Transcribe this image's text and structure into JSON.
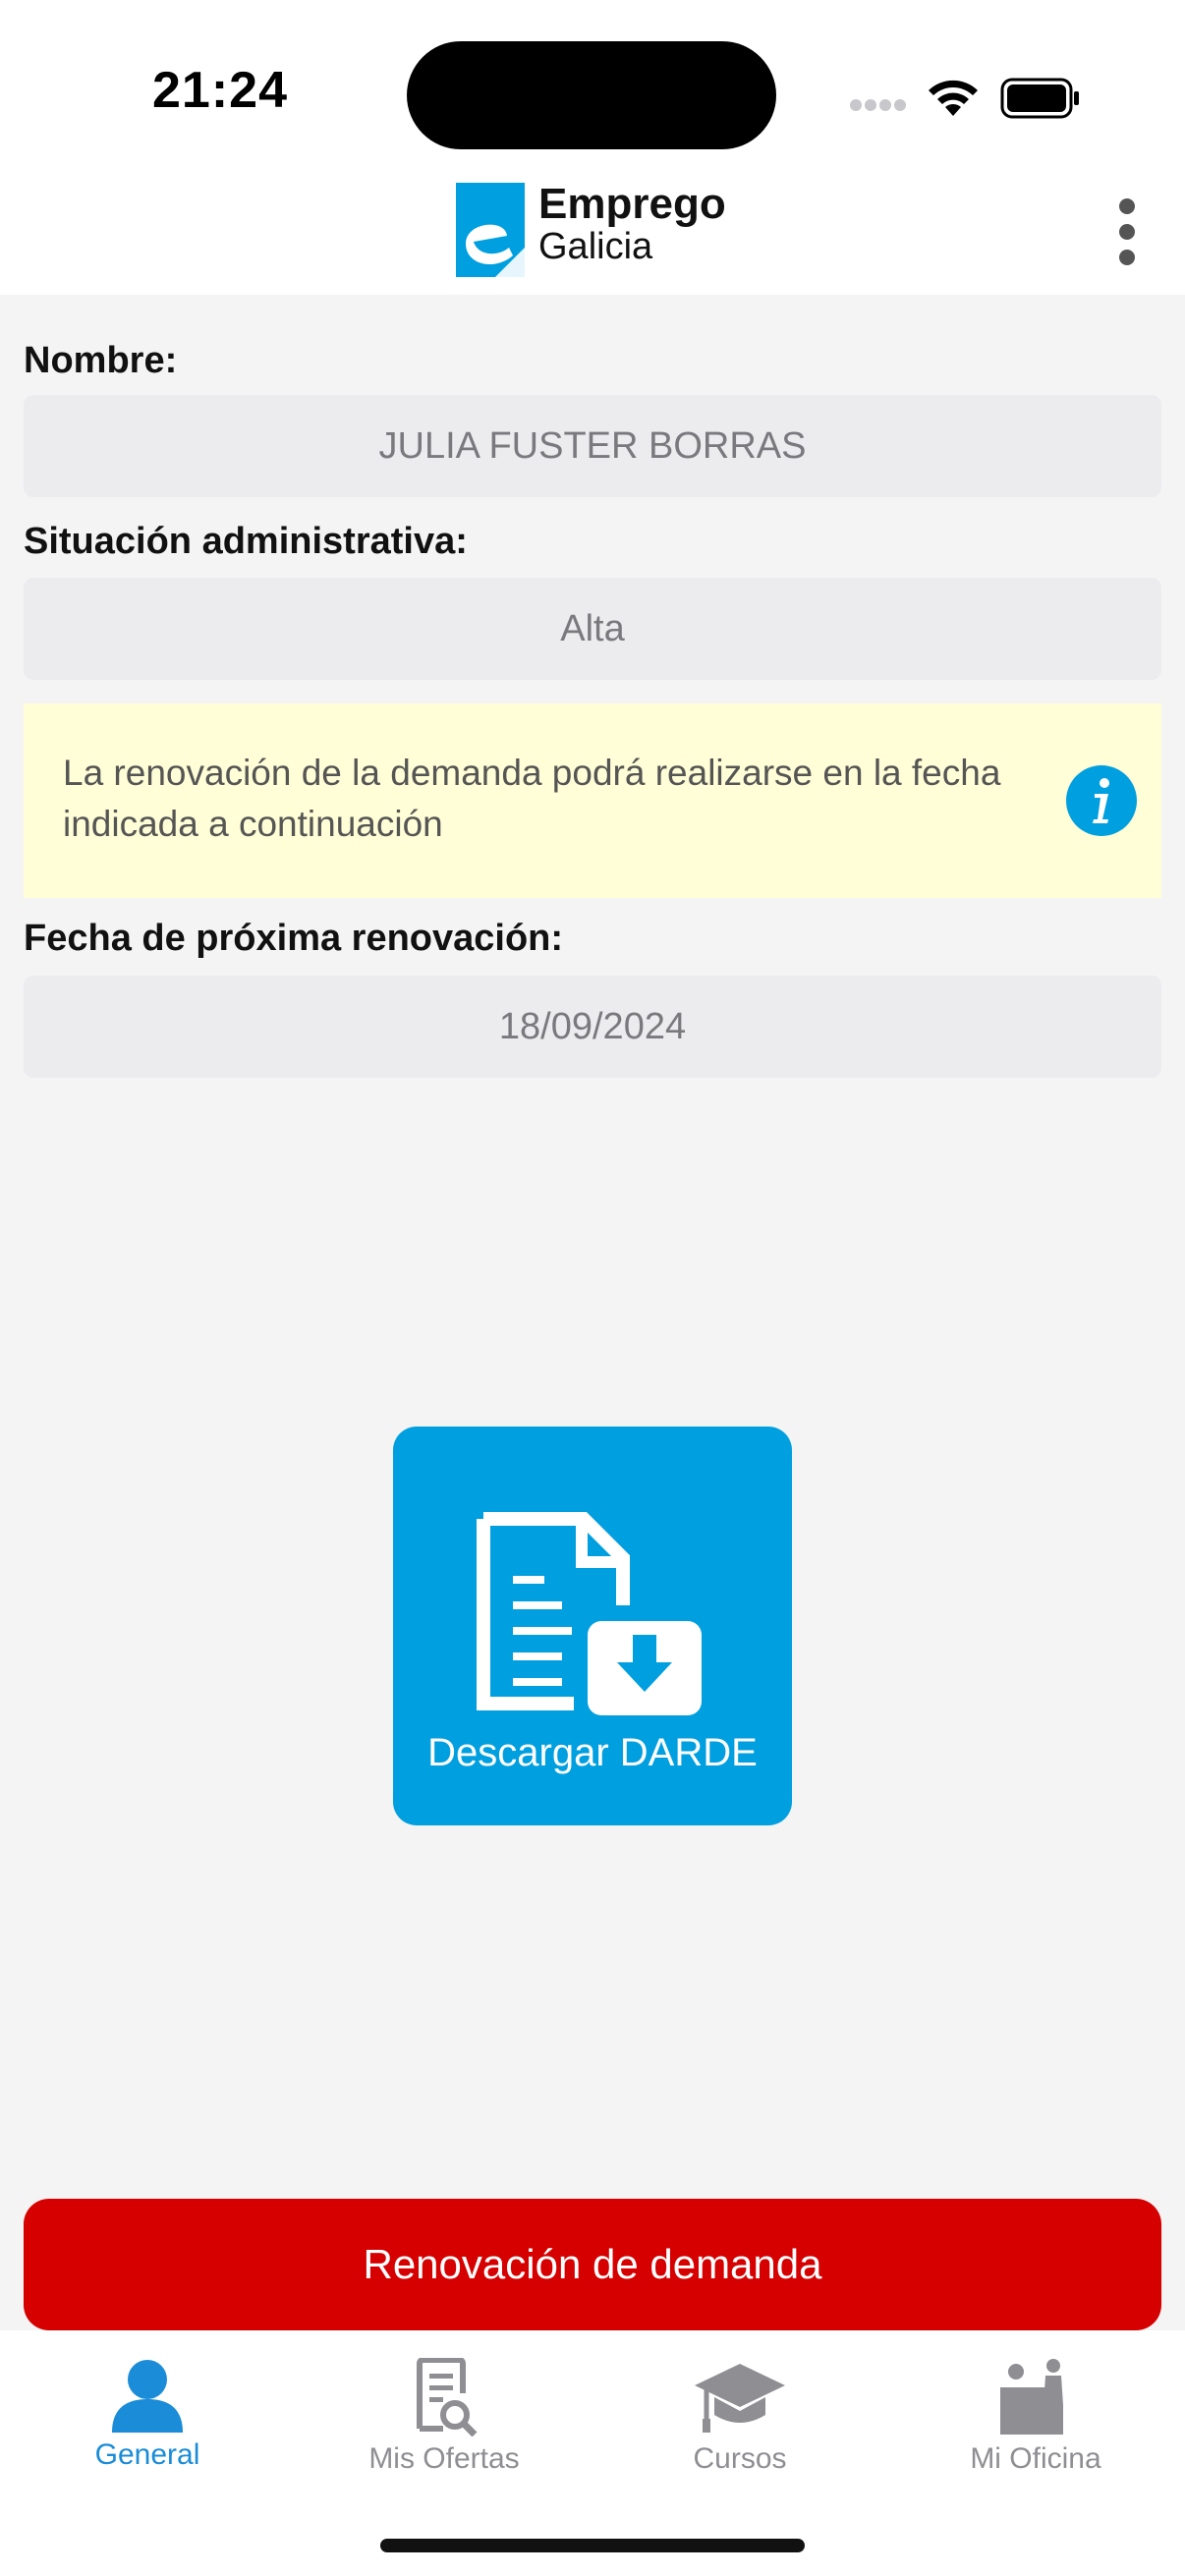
{
  "status_bar": {
    "time": "21:24"
  },
  "header": {
    "logo_line1": "Emprego",
    "logo_line2": "Galicia",
    "menu_icon": "more-vertical-icon"
  },
  "form": {
    "name_label": "Nombre:",
    "name_value": "JULIA FUSTER BORRAS",
    "status_label": "Situación administrativa:",
    "status_value": "Alta",
    "notice": "La renovación de la demanda podrá realizarse en la fecha indicada a continuación",
    "renewal_label": "Fecha de próxima renovación:",
    "renewal_value": "18/09/2024"
  },
  "download": {
    "label": "Descargar DARDE",
    "icon": "document-download-icon"
  },
  "renew_button": {
    "label": "Renovación de demanda"
  },
  "tabs": [
    {
      "label": "General",
      "icon": "person-icon",
      "active": true
    },
    {
      "label": "Mis Ofertas",
      "icon": "document-search-icon",
      "active": false
    },
    {
      "label": "Cursos",
      "icon": "graduation-cap-icon",
      "active": false
    },
    {
      "label": "Mi Oficina",
      "icon": "office-desk-icon",
      "active": false
    }
  ],
  "colors": {
    "accent_blue": "#009fe0",
    "tab_active": "#1a8cd8",
    "renew_red": "#d60000",
    "notice_bg": "#fffed6"
  }
}
